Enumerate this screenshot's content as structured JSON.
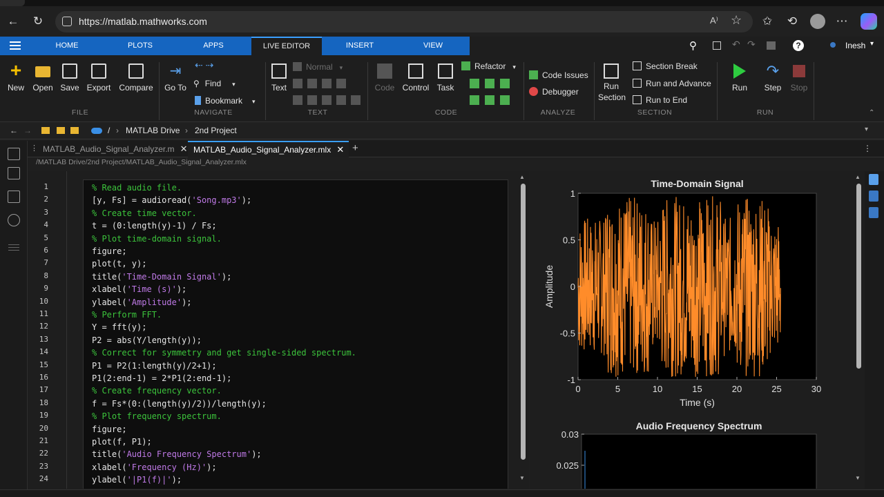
{
  "browser": {
    "url": "https://matlab.mathworks.com",
    "read_aloud": "A⁾"
  },
  "ribbon_tabs": [
    "HOME",
    "PLOTS",
    "APPS",
    "LIVE EDITOR",
    "INSERT",
    "VIEW"
  ],
  "active_tab": "LIVE EDITOR",
  "user": "Inesh",
  "file_group": {
    "buttons": [
      "New",
      "Open",
      "Save",
      "Export",
      "Compare"
    ],
    "label": "FILE"
  },
  "navigate_group": {
    "goto": "Go To",
    "find": "Find",
    "bookmark": "Bookmark",
    "label": "NAVIGATE"
  },
  "text_group": {
    "text": "Text",
    "style": "Normal",
    "label": "TEXT"
  },
  "code_group": {
    "code": "Code",
    "control": "Control",
    "task": "Task",
    "refactor": "Refactor",
    "label": "CODE"
  },
  "analyze_group": {
    "issues": "Code Issues",
    "debugger": "Debugger",
    "label": "ANALYZE"
  },
  "section_group": {
    "run_section": "Run Section",
    "break": "Section Break",
    "run_advance": "Run and Advance",
    "run_end": "Run to End",
    "label": "SECTION"
  },
  "run_group": {
    "run": "Run",
    "step": "Step",
    "stop": "Stop",
    "label": "RUN"
  },
  "path": {
    "root": "/",
    "drive": "MATLAB Drive",
    "folder": "2nd Project"
  },
  "file_tabs": [
    "MATLAB_Audio_Signal_Analyzer.m",
    "MATLAB_Audio_Signal_Analyzer.mlx"
  ],
  "file_path": "/MATLAB Drive/2nd Project/MATLAB_Audio_Signal_Analyzer.mlx",
  "code_lines": [
    [
      [
        "c",
        "% Read audio file."
      ]
    ],
    [
      [
        "t",
        "[y, Fs] = audioread("
      ],
      [
        "s",
        "'Song.mp3'"
      ],
      [
        "t",
        ");"
      ]
    ],
    [
      [
        "c",
        "% Create time vector."
      ]
    ],
    [
      [
        "t",
        "t = (0:length(y)-1) / Fs;"
      ]
    ],
    [
      [
        "c",
        "% Plot time-domain signal."
      ]
    ],
    [
      [
        "t",
        "figure;"
      ]
    ],
    [
      [
        "t",
        "plot(t, y);"
      ]
    ],
    [
      [
        "t",
        "title("
      ],
      [
        "s",
        "'Time-Domain Signal'"
      ],
      [
        "t",
        ");"
      ]
    ],
    [
      [
        "t",
        "xlabel("
      ],
      [
        "s",
        "'Time (s)'"
      ],
      [
        "t",
        ");"
      ]
    ],
    [
      [
        "t",
        "ylabel("
      ],
      [
        "s",
        "'Amplitude'"
      ],
      [
        "t",
        ");"
      ]
    ],
    [
      [
        "c",
        "% Perform FFT."
      ]
    ],
    [
      [
        "t",
        "Y = fft(y);"
      ]
    ],
    [
      [
        "t",
        "P2 = abs(Y/length(y));"
      ]
    ],
    [
      [
        "c",
        "% Correct for symmetry and get single-sided spectrum."
      ]
    ],
    [
      [
        "t",
        "P1 = P2(1:length(y)/2+1);"
      ]
    ],
    [
      [
        "t",
        "P1(2:end-1) = 2*P1(2:end-1);"
      ]
    ],
    [
      [
        "c",
        "% Create frequency vector."
      ]
    ],
    [
      [
        "t",
        "f = Fs*(0:(length(y)/2))/length(y);"
      ]
    ],
    [
      [
        "c",
        "% Plot frequency spectrum."
      ]
    ],
    [
      [
        "t",
        "figure;"
      ]
    ],
    [
      [
        "t",
        "plot(f, P1);"
      ]
    ],
    [
      [
        "t",
        "title("
      ],
      [
        "s",
        "'Audio Frequency Spectrum'"
      ],
      [
        "t",
        ");"
      ]
    ],
    [
      [
        "t",
        "xlabel("
      ],
      [
        "s",
        "'Frequency (Hz)'"
      ],
      [
        "t",
        ");"
      ]
    ],
    [
      [
        "t",
        "ylabel("
      ],
      [
        "s",
        "'|P1(f)|'"
      ],
      [
        "t",
        ");"
      ]
    ]
  ],
  "chart_data": [
    {
      "type": "line",
      "title": "Time-Domain Signal",
      "xlabel": "Time (s)",
      "ylabel": "Amplitude",
      "xlim": [
        0,
        30
      ],
      "ylim": [
        -1,
        1
      ],
      "xticks": [
        0,
        5,
        10,
        15,
        20,
        25,
        30
      ],
      "yticks": [
        1,
        0.5,
        0,
        -0.5,
        -1
      ],
      "signal_end": 25.5,
      "color": "#ff8c2a"
    },
    {
      "type": "line",
      "title": "Audio Frequency Spectrum",
      "yticks": [
        0.03,
        0.025
      ],
      "color": "#3a8fe6"
    }
  ]
}
